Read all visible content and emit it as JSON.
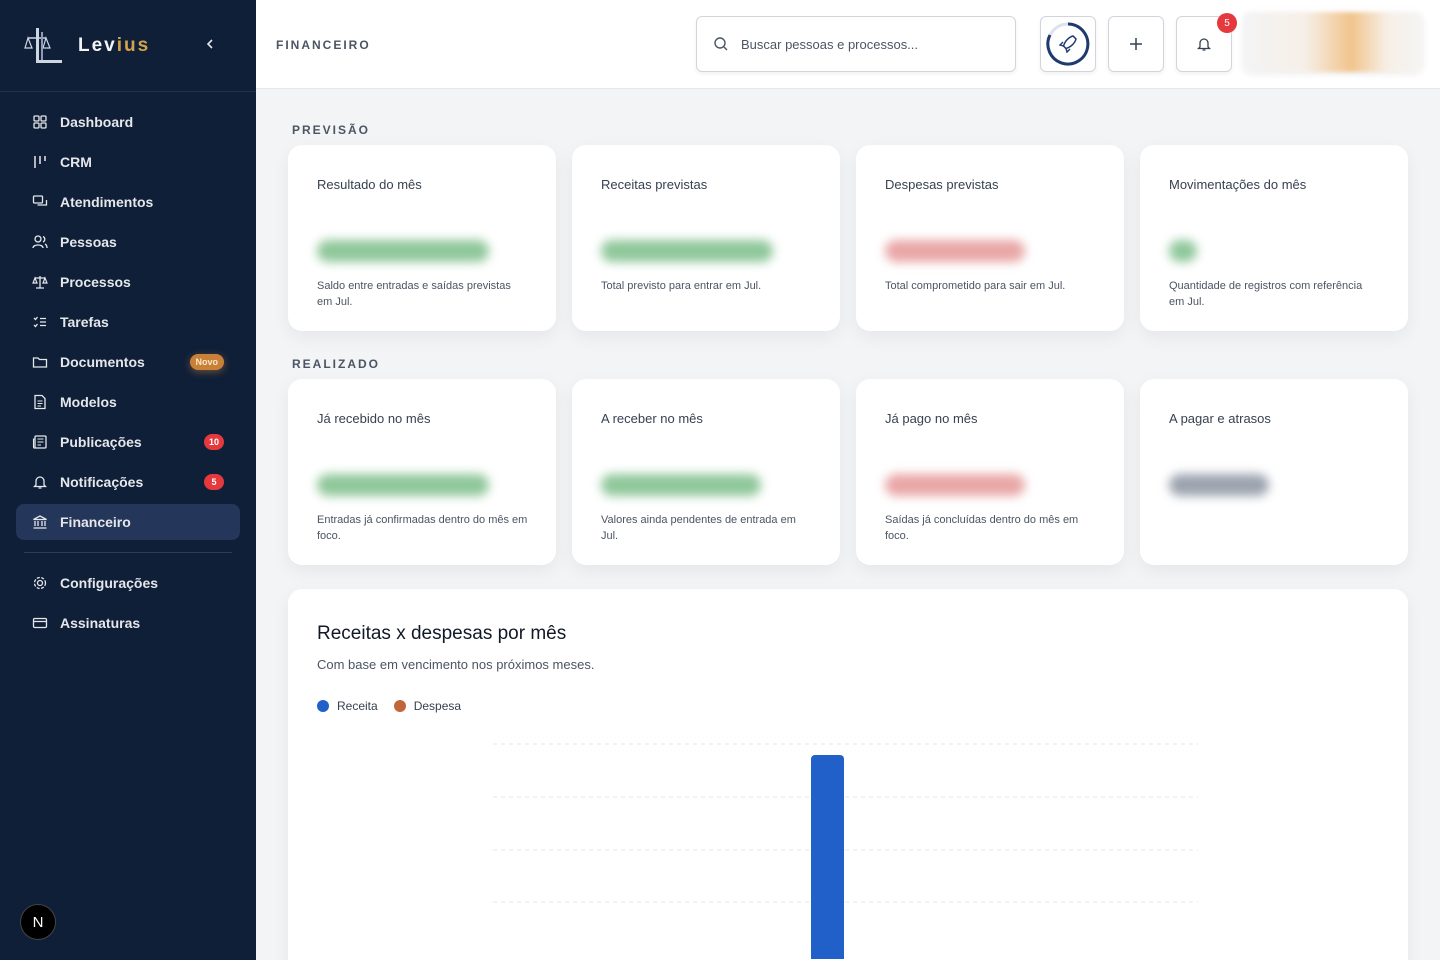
{
  "brand": {
    "name_main": "Lev",
    "name_accent": "ius"
  },
  "header": {
    "title": "FINANCEIRO",
    "search_placeholder": "Buscar pessoas e processos...",
    "notifications_count": "5"
  },
  "sidebar": {
    "items": [
      {
        "label": "Dashboard",
        "icon": "dashboard-icon"
      },
      {
        "label": "CRM",
        "icon": "crm-icon"
      },
      {
        "label": "Atendimentos",
        "icon": "chat-icon"
      },
      {
        "label": "Pessoas",
        "icon": "users-icon"
      },
      {
        "label": "Processos",
        "icon": "scale-icon"
      },
      {
        "label": "Tarefas",
        "icon": "tasks-icon"
      },
      {
        "label": "Documentos",
        "icon": "folder-icon",
        "badge": "Novo"
      },
      {
        "label": "Modelos",
        "icon": "file-icon"
      },
      {
        "label": "Publicações",
        "icon": "newspaper-icon",
        "badge": "10"
      },
      {
        "label": "Notificações",
        "icon": "bell-icon",
        "badge": "5"
      },
      {
        "label": "Financeiro",
        "icon": "bank-icon",
        "active": true
      }
    ],
    "bottom_items": [
      {
        "label": "Configurações",
        "icon": "gear-icon"
      },
      {
        "label": "Assinaturas",
        "icon": "card-icon"
      }
    ],
    "user_initial": "N"
  },
  "previsao": {
    "label": "PREVISÃO",
    "cards": [
      {
        "title": "Resultado do mês",
        "desc": "Saldo entre entradas e saídas previstas em Jul."
      },
      {
        "title": "Receitas previstas",
        "desc": "Total previsto para entrar em Jul."
      },
      {
        "title": "Despesas previstas",
        "desc": "Total comprometido para sair em Jul."
      },
      {
        "title": "Movimentações do mês",
        "desc": "Quantidade de registros com referência em Jul."
      }
    ]
  },
  "realizado": {
    "label": "REALIZADO",
    "cards": [
      {
        "title": "Já recebido no mês",
        "desc": "Entradas já confirmadas dentro do mês em foco."
      },
      {
        "title": "A receber no mês",
        "desc": "Valores ainda pendentes de entrada em Jul."
      },
      {
        "title": "Já pago no mês",
        "desc": "Saídas já concluídas dentro do mês em foco."
      },
      {
        "title": "A pagar e atrasos",
        "desc": ""
      }
    ]
  },
  "chart_section": {
    "title": "Receitas x despesas por mês",
    "subtitle": "Com base em vencimento nos próximos meses."
  },
  "colors": {
    "receita": "#2160c9",
    "despesa": "#c0663d",
    "sidebar": "#0f1f38"
  },
  "chart_data": {
    "type": "bar",
    "categories": [],
    "series": [
      {
        "name": "Receita",
        "values": [
          1
        ]
      },
      {
        "name": "Despesa",
        "values": [
          0
        ]
      }
    ],
    "title": "Receitas x despesas por mês",
    "xlabel": "",
    "ylabel": "",
    "grid": true,
    "legend": "top-left"
  }
}
